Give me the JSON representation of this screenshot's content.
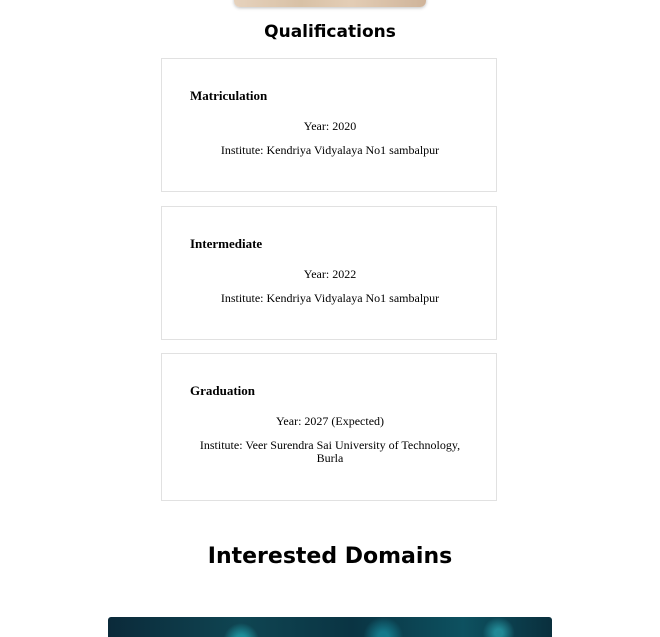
{
  "qualifications": {
    "title": "Qualifications",
    "items": [
      {
        "name": "Matriculation",
        "year": "Year: 2020",
        "institute": "Institute: Kendriya Vidyalaya No1 sambalpur"
      },
      {
        "name": "Intermediate",
        "year": "Year: 2022",
        "institute": "Institute: Kendriya Vidyalaya No1 sambalpur"
      },
      {
        "name": "Graduation",
        "year": "Year: 2027 (Expected)",
        "institute": "Institute: Veer Surendra Sai University of Technology, Burla"
      }
    ]
  },
  "domains": {
    "title": "Interested Domains"
  }
}
